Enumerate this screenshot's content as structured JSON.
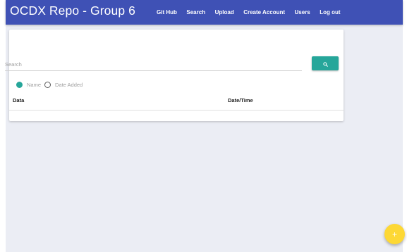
{
  "navbar": {
    "brand": "OCDX Repo - Group 6",
    "links": [
      {
        "label": "Git Hub"
      },
      {
        "label": "Search"
      },
      {
        "label": "Upload"
      },
      {
        "label": "Create Account"
      },
      {
        "label": "Users"
      },
      {
        "label": "Log out"
      }
    ],
    "color": "#3f51b5"
  },
  "search": {
    "placeholder": "Search",
    "value": "",
    "button_icon": "search-icon",
    "button_color": "#26a69a"
  },
  "filter": {
    "options": [
      {
        "label": "Name",
        "checked": true
      },
      {
        "label": "Date Added",
        "checked": false
      }
    ]
  },
  "table": {
    "columns": [
      "Data",
      "Date/Time"
    ],
    "rows": []
  },
  "fab": {
    "icon": "plus-icon",
    "glyph": "+",
    "color": "#fdd835"
  }
}
